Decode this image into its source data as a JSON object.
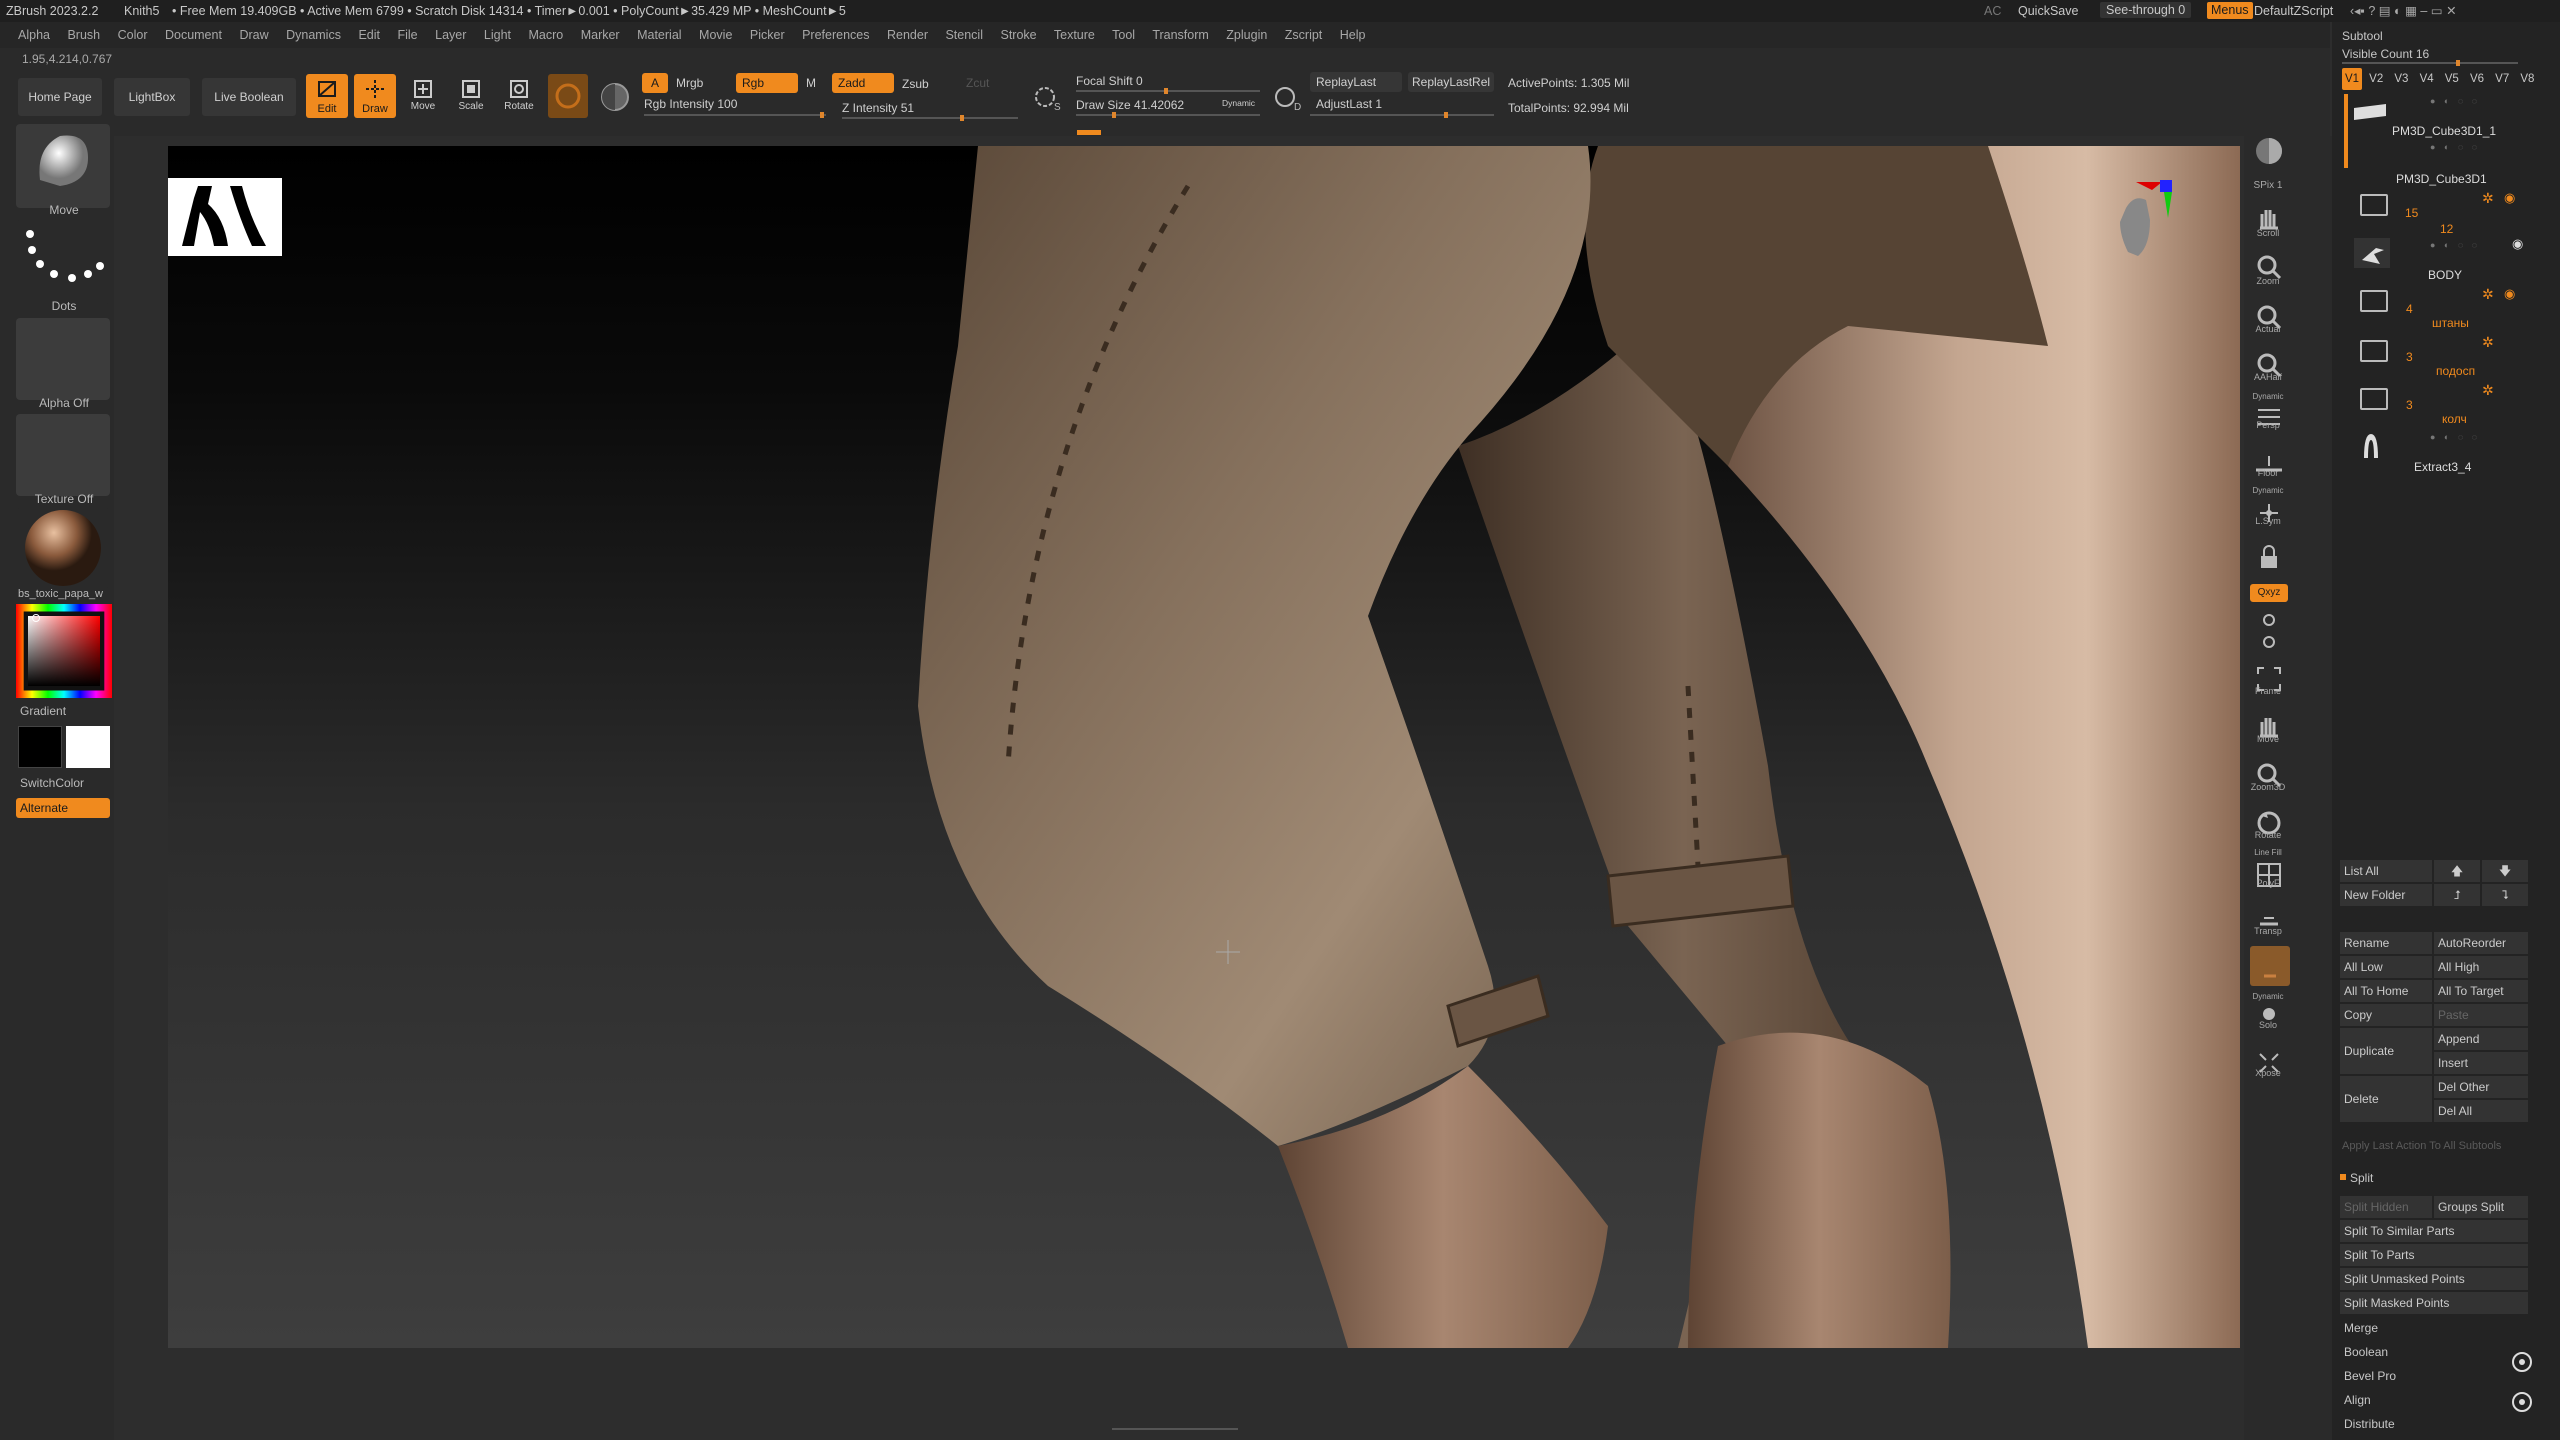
{
  "titlebar": {
    "app": "ZBrush 2023.2.2",
    "doc": "Knith5",
    "stats": "• Free Mem 19.409GB • Active Mem 6799 • Scratch Disk 14314 • Timer►0.001 • PolyCount►35.429 MP • MeshCount►5",
    "ac": "AC",
    "quicksave": "QuickSave",
    "seethrough": "See-through  0",
    "menus": "Menus",
    "script": "DefaultZScript"
  },
  "menubar": [
    "Alpha",
    "Brush",
    "Color",
    "Document",
    "Draw",
    "Dynamics",
    "Edit",
    "File",
    "Layer",
    "Light",
    "Macro",
    "Marker",
    "Material",
    "Movie",
    "Picker",
    "Preferences",
    "Render",
    "Stencil",
    "Stroke",
    "Texture",
    "Tool",
    "Transform",
    "Zplugin",
    "Zscript",
    "Help"
  ],
  "coords": "1.95,4.214,0.767",
  "topshelf": {
    "home": "Home Page",
    "lightbox": "LightBox",
    "liveboolean": "Live Boolean",
    "edit": "Edit",
    "draw": "Draw",
    "move": "Move",
    "scale": "Scale",
    "rotate": "Rotate",
    "a": "A",
    "mrgb": "Mrgb",
    "rgb": "Rgb",
    "m": "M",
    "zadd": "Zadd",
    "zsub": "Zsub",
    "zcut": "Zcut",
    "rgb_intensity": "Rgb Intensity 100",
    "z_intensity": "Z Intensity 51",
    "focal_shift": "Focal Shift 0",
    "draw_size": "Draw Size 41.42062",
    "dynamic": "Dynamic",
    "replaylast": "ReplayLast",
    "replaylastrel": "ReplayLastRel",
    "adjustlast": "AdjustLast 1",
    "active_points": "ActivePoints: 1.305 Mil",
    "total_points": "TotalPoints: 92.994 Mil"
  },
  "leftshelf": {
    "brush": "Move",
    "stroke": "Dots",
    "alpha": "Alpha Off",
    "texture": "Texture Off",
    "material": "bs_toxic_papa_w",
    "gradient": "Gradient",
    "switchcolor": "SwitchColor",
    "alternate": "Alternate"
  },
  "rightshelf": [
    "BPR",
    "SPix 1",
    "Scroll",
    "Zoom",
    "Actual",
    "AAHalf",
    "Dynamic",
    "Persp",
    "Floor",
    "Dynamic",
    "L.Sym",
    "",
    "Qxyz",
    "",
    "",
    "Frame",
    "Move",
    "Zoom3D",
    "Rotate",
    "Line Fill",
    "PolyF",
    "Transp",
    "Ghost",
    "Dynamic",
    "Solo",
    "Xpose"
  ],
  "subtool": {
    "header": "Subtool",
    "visible_count": "Visible Count 16",
    "versions": [
      "V1",
      "V2",
      "V3",
      "V4",
      "V5",
      "V6",
      "V7",
      "V8"
    ],
    "items": [
      {
        "name": "PM3D_Cube3D1_1"
      },
      {
        "name": "PM3D_Cube3D1"
      },
      {
        "name": "BODY"
      },
      {
        "name": "штаны"
      },
      {
        "name": "подосп"
      },
      {
        "name": "колч"
      },
      {
        "name": "Extract3_4"
      }
    ],
    "folder_counts": [
      "15",
      "12",
      "4",
      "3",
      "3"
    ],
    "list_all": "List All",
    "new_folder": "New Folder",
    "rename": "Rename",
    "autoreorder": "AutoReorder",
    "all_low": "All Low",
    "all_high": "All High",
    "all_to_home": "All To Home",
    "all_to_target": "All To Target",
    "copy": "Copy",
    "paste": "Paste",
    "duplicate": "Duplicate",
    "append": "Append",
    "insert": "Insert",
    "delete": "Delete",
    "del_other": "Del Other",
    "del_all": "Del All",
    "apply_last": "Apply Last Action To All Subtools",
    "split": "Split",
    "split_hidden": "Split Hidden",
    "groups_split": "Groups Split",
    "split_similar": "Split To Similar Parts",
    "split_parts": "Split To Parts",
    "split_unmasked": "Split Unmasked Points",
    "split_masked": "Split Masked Points",
    "merge": "Merge",
    "boolean": "Boolean",
    "bevel_pro": "Bevel Pro",
    "align": "Align",
    "distribute": "Distribute"
  }
}
